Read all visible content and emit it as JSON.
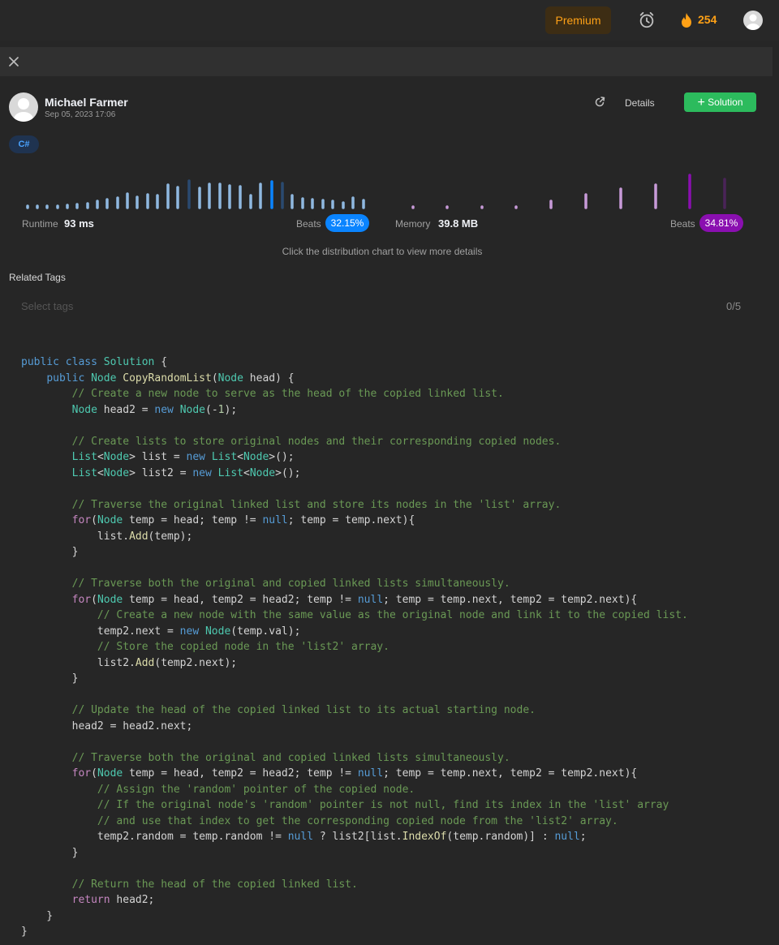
{
  "topnav": {
    "premium_label": "Premium",
    "streak_count": "254",
    "icons": [
      "alarm-icon",
      "fire-icon",
      "avatar"
    ]
  },
  "panel": {
    "close_icon": "close-icon",
    "author": {
      "name": "Michael Farmer",
      "date": "Sep 05, 2023 17:06"
    },
    "actions": {
      "details_label": "Details",
      "solution_label": "Solution"
    },
    "language_tag": "C#"
  },
  "stats": {
    "runtime_label": "Runtime",
    "runtime_value": "93 ms",
    "runtime_beats_label": "Beats",
    "runtime_beats": "32.15%",
    "memory_label": "Memory",
    "memory_value": "39.8 MB",
    "memory_beats_label": "Beats",
    "memory_beats": "34.81%",
    "hint": "Click the distribution chart to view more details"
  },
  "tags": {
    "label": "Related Tags",
    "placeholder": "Select tags",
    "count": "0/5"
  },
  "colors": {
    "accent_runtime": "#0a84ff",
    "accent_memory": "#8a0fb0",
    "solution_green": "#2cbb5d",
    "premium_orange": "#ffa116"
  }
}
